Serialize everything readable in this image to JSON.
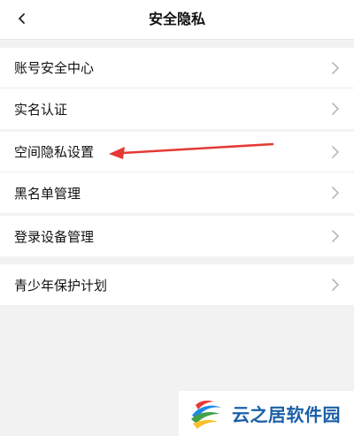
{
  "header": {
    "title": "安全隐私"
  },
  "groups": {
    "account": {
      "items": [
        {
          "label": "账号安全中心"
        },
        {
          "label": "实名认证"
        }
      ]
    },
    "privacy": {
      "items": [
        {
          "label": "空间隐私设置"
        },
        {
          "label": "黑名单管理"
        }
      ]
    },
    "device": {
      "items": [
        {
          "label": "登录设备管理"
        }
      ]
    },
    "youth": {
      "items": [
        {
          "label": "青少年保护计划"
        }
      ]
    }
  },
  "annotation": {
    "arrow_color": "#e53935"
  },
  "watermark": {
    "text": "云之居软件园"
  },
  "colors": {
    "background": "#f2f2f2",
    "row": "#ffffff",
    "chevron": "#b8b8b8"
  }
}
